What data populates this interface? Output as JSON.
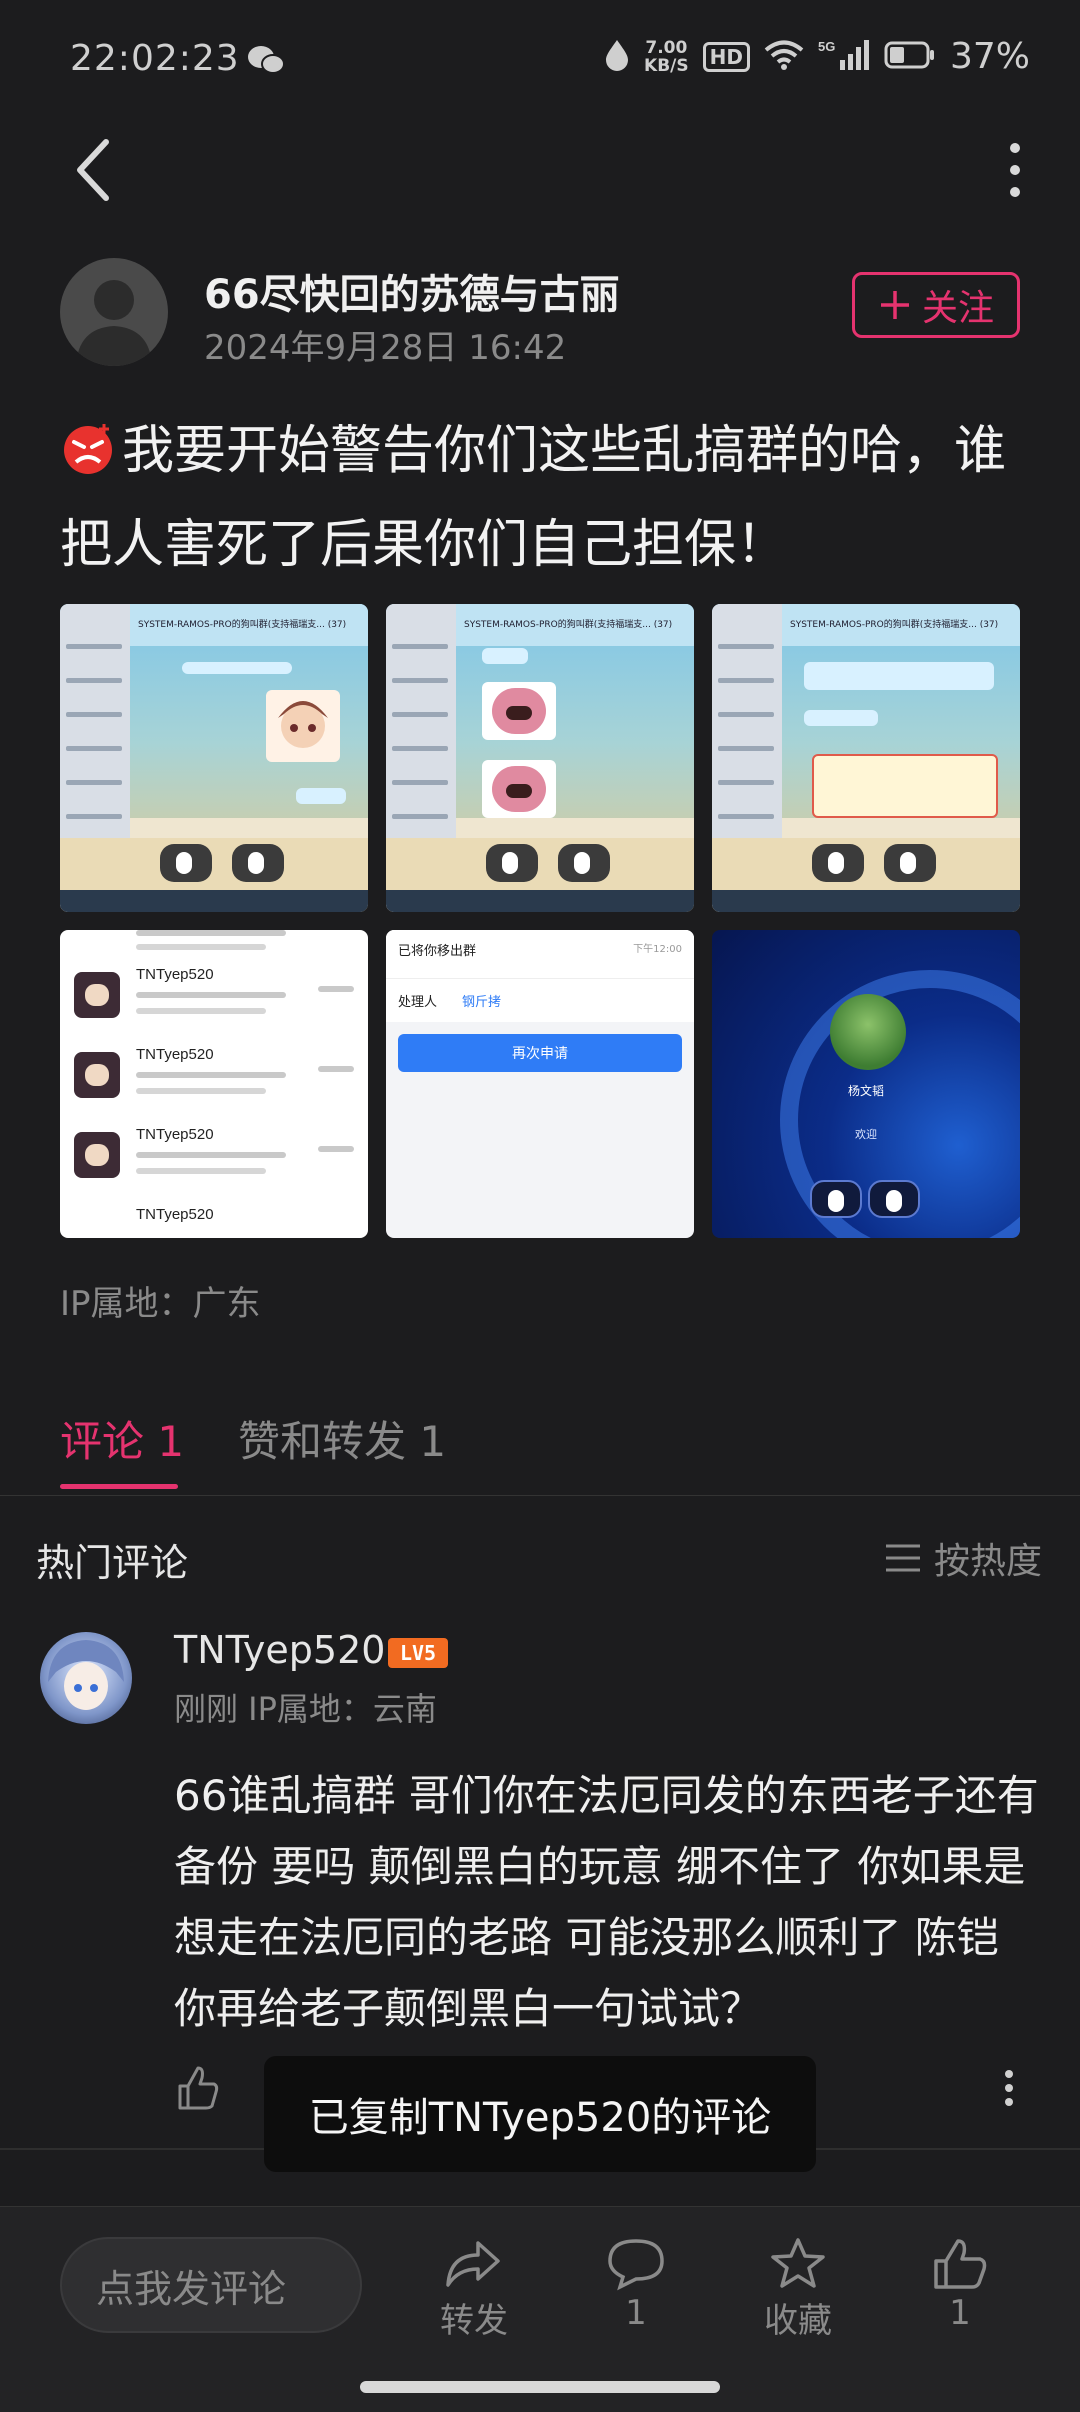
{
  "status_bar": {
    "time": "22:02:23",
    "net_speed_value": "7.00",
    "net_speed_unit": "KB/S",
    "hd": "HD",
    "network": "5G",
    "battery": "37%"
  },
  "author": {
    "name": "66尽快回的苏德与古丽",
    "date": "2024年9月28日 16:42",
    "follow_label": "关注"
  },
  "post": {
    "text": "我要开始警告你们这些乱搞群的哈，谁把人害死了后果你们自己担保！",
    "ip_location": "IP属地：广东"
  },
  "images": {
    "chat_title": "SYSTEM-RAMOS-PRO的狗叫群(支持福瑞支... (37)",
    "list_name": "TNTyep520",
    "removed_title": "已将你移出群",
    "removed_time": "下午12:00",
    "removed_tab_handler": "处理人",
    "removed_tab_value": "钢斤拷",
    "reapply_button": "再次申请",
    "desktop_user": "杨文韬",
    "desktop_welcome": "欢迎"
  },
  "tabs": [
    {
      "label": "评论 1"
    },
    {
      "label": "赞和转发 1"
    }
  ],
  "hot_comments": {
    "heading": "热门评论",
    "sort_label": "按热度"
  },
  "comment": {
    "user": "TNTyep520",
    "level": "LV5",
    "meta": "刚刚  IP属地：云南",
    "text": "66谁乱搞群 哥们你在法厄同发的东西老子还有备份 要吗 颠倒黑白的玩意 绷不住了 你如果是想走在法厄同的老路 可能没那么顺利了 陈铠 你再给老子颠倒黑白一句试试？"
  },
  "toast": "已复制TNTyep520的评论",
  "bottom_bar": {
    "input_placeholder": "点我发评论",
    "repost_label": "转发",
    "comment_count": "1",
    "favorite_label": "收藏",
    "like_count": "1"
  },
  "colors": {
    "accent": "#e5336f",
    "background": "#1c1c1e",
    "level_badge": "#f26b21"
  }
}
